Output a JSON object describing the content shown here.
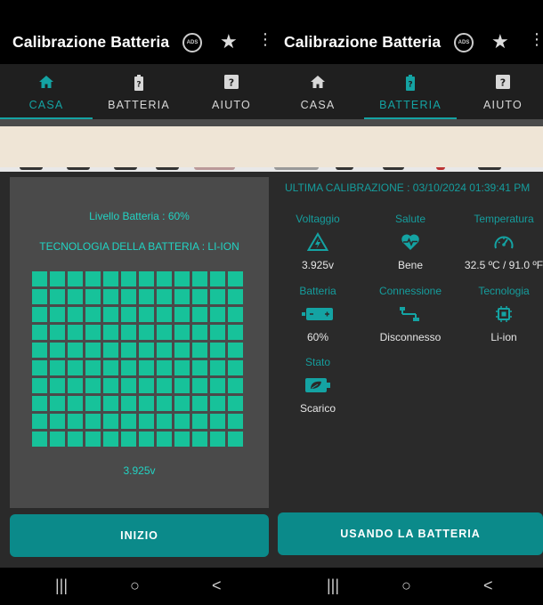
{
  "left": {
    "app_title": "Calibrazione Batteria",
    "ads_label": "ADS",
    "tabs": [
      {
        "label": "CASA",
        "active": true
      },
      {
        "label": "BATTERIA",
        "active": false
      },
      {
        "label": "AIUTO",
        "active": false
      }
    ],
    "battery_level": "Livello Batteria  :  60%",
    "technology": "TECNOLOGIA DELLA BATTERIA  :  LI-ION",
    "voltage": "3.925v",
    "start_button": "INIZIO"
  },
  "right": {
    "app_title": "Calibrazione Batteria",
    "ads_label": "ADS",
    "tabs": [
      {
        "label": "CASA",
        "active": false
      },
      {
        "label": "BATTERIA",
        "active": true
      },
      {
        "label": "AIUTO",
        "active": false
      }
    ],
    "last_calibration": "ULTIMA CALIBRAZIONE  :  03/10/2024 01:39:41 PM",
    "metrics": {
      "voltaggio": {
        "label": "Voltaggio",
        "value": "3.925v",
        "icon": "voltage-warning-icon"
      },
      "salute": {
        "label": "Salute",
        "value": "Bene",
        "icon": "heart-pulse-icon"
      },
      "temperatura": {
        "label": "Temperatura",
        "value": "32.5 ºC / 91.0 ºF",
        "icon": "gauge-icon"
      },
      "batteria": {
        "label": "Batteria",
        "value": "60%",
        "icon": "battery-icon"
      },
      "connessione": {
        "label": "Connessione",
        "value": "Disconnesso",
        "icon": "plug-icon"
      },
      "tecnologia": {
        "label": "Tecnologia",
        "value": "Li-ion",
        "icon": "chip-icon"
      },
      "stato": {
        "label": "Stato",
        "value": "Scarico",
        "icon": "battery-leaf-icon"
      }
    },
    "using_battery_button": "USANDO LA BATTERIA"
  },
  "navbar": {
    "recents": "|||",
    "home": "○",
    "back": "<"
  },
  "colors": {
    "accent": "#14a3a3",
    "cell": "#17c29a",
    "button": "#0b8a8a",
    "card": "#4a4a4a",
    "background": "#2a2a2a"
  }
}
